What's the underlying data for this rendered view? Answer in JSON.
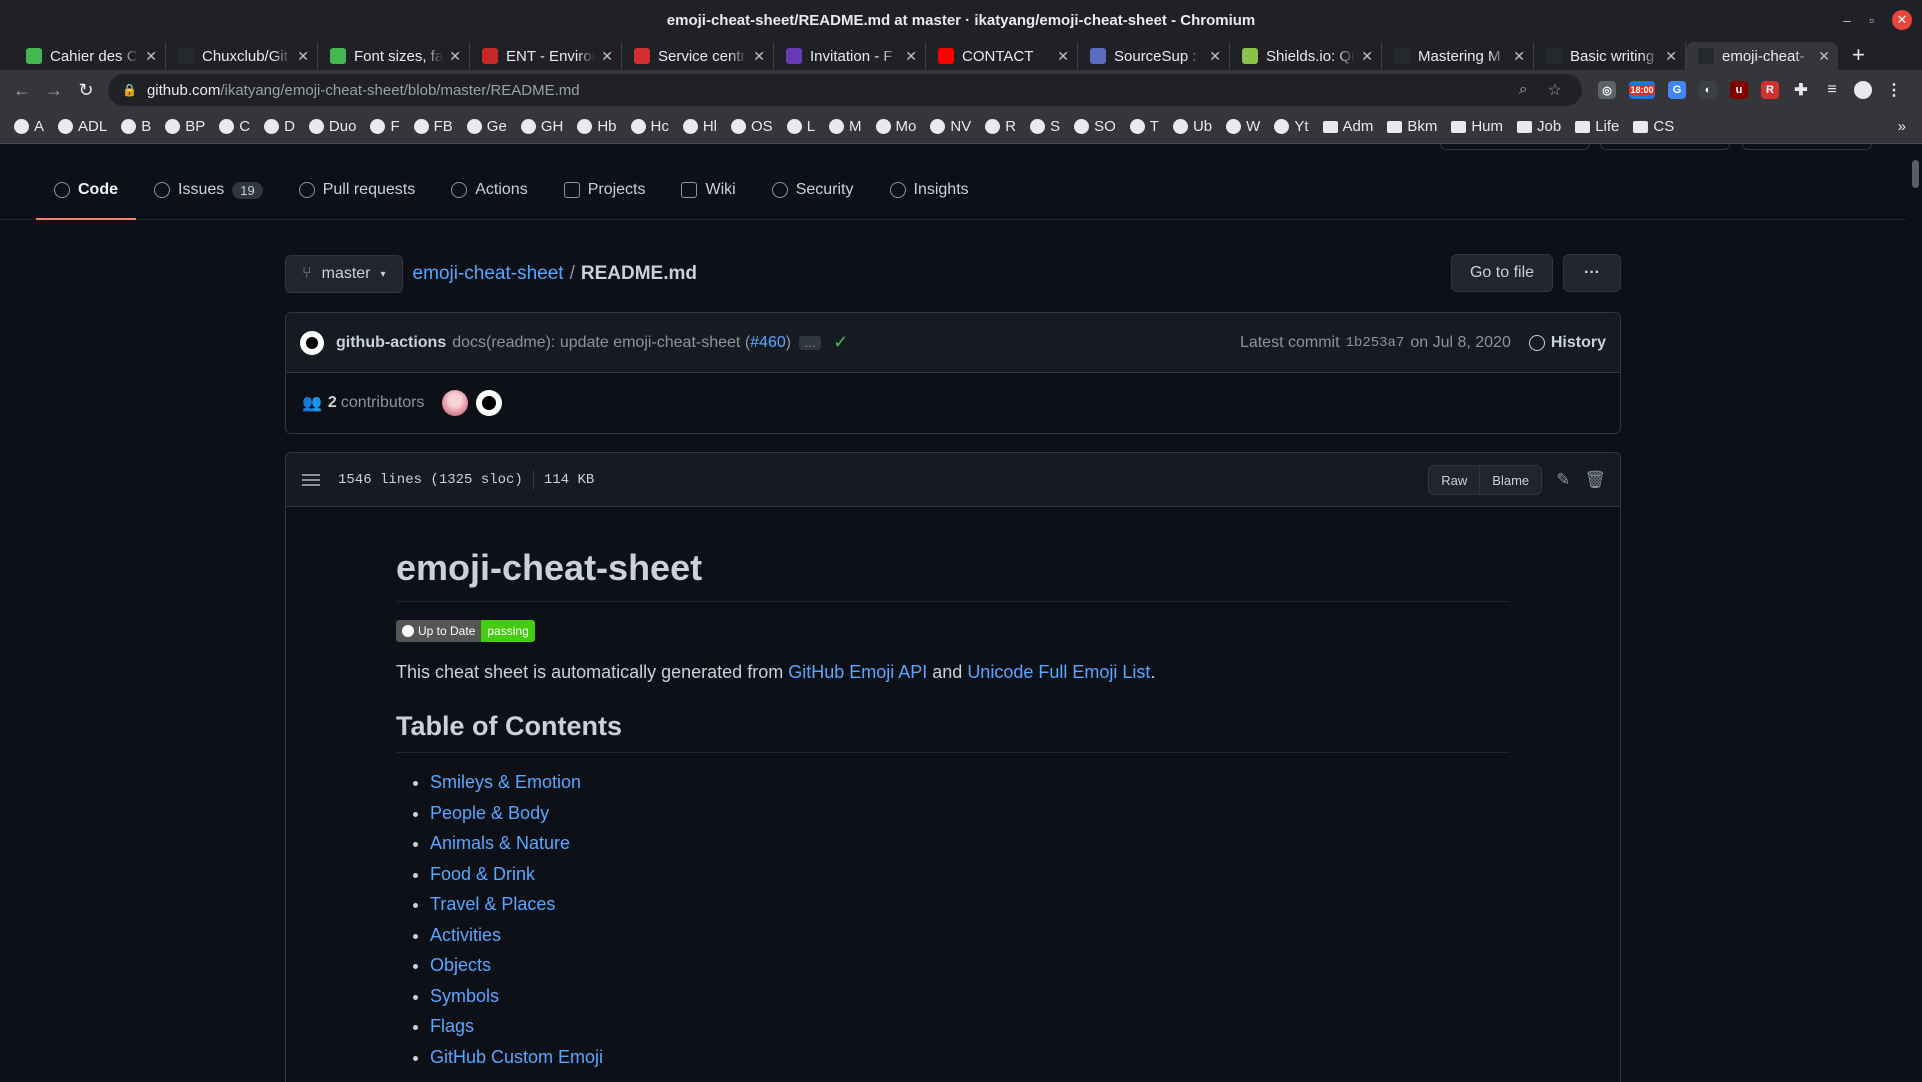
{
  "window": {
    "title": "emoji-cheat-sheet/README.md at master · ikatyang/emoji-cheat-sheet - Chromium"
  },
  "tabs": [
    {
      "label": "Cahier des Ch",
      "icon": "page-icon",
      "color": "#3fb950"
    },
    {
      "label": "Chuxclub/Git",
      "icon": "github-icon",
      "color": "#24292f"
    },
    {
      "label": "Font sizes, fa",
      "icon": "page-icon",
      "color": "#3fb950"
    },
    {
      "label": "ENT - Environ",
      "icon": "ent-icon",
      "color": "#c62828"
    },
    {
      "label": "Service centr",
      "icon": "service-icon",
      "color": "#d32f2f"
    },
    {
      "label": "Invitation - F",
      "icon": "form-icon",
      "color": "#673ab7"
    },
    {
      "label": "CONTACT",
      "icon": "youtube-icon",
      "color": "#ff0000"
    },
    {
      "label": "SourceSup : I",
      "icon": "sourcesup-icon",
      "color": "#5c6bc0"
    },
    {
      "label": "Shields.io: Qu",
      "icon": "shields-icon",
      "color": "#8bc34a"
    },
    {
      "label": "Mastering M",
      "icon": "github-icon",
      "color": "#24292f"
    },
    {
      "label": "Basic writing",
      "icon": "github-icon",
      "color": "#24292f"
    },
    {
      "label": "emoji-cheat-",
      "icon": "github-icon",
      "color": "#24292f"
    }
  ],
  "omnibox": {
    "host": "github.com",
    "path": "/ikatyang/emoji-cheat-sheet/blob/master/README.md"
  },
  "extensions": {
    "clock_badge": "18:00"
  },
  "bookmarks": [
    "A",
    "ADL",
    "B",
    "BP",
    "C",
    "D",
    "Duo",
    "F",
    "FB",
    "Ge",
    "GH",
    "Hb",
    "Hc",
    "Hl",
    "OS",
    "L",
    "M",
    "Mo",
    "NV",
    "R",
    "S",
    "SO",
    "T",
    "Ub",
    "W",
    "Yt"
  ],
  "bookmark_folders": [
    "Adm",
    "Bkm",
    "Hum",
    "Job",
    "Life",
    "CS"
  ],
  "repo_nav": [
    {
      "label": "Code",
      "icon": "code-icon"
    },
    {
      "label": "Issues",
      "icon": "issue-icon",
      "count": "19"
    },
    {
      "label": "Pull requests",
      "icon": "pull-request-icon"
    },
    {
      "label": "Actions",
      "icon": "actions-icon"
    },
    {
      "label": "Projects",
      "icon": "projects-icon"
    },
    {
      "label": "Wiki",
      "icon": "wiki-icon"
    },
    {
      "label": "Security",
      "icon": "shield-icon"
    },
    {
      "label": "Insights",
      "icon": "graph-icon"
    }
  ],
  "branch": "master",
  "breadcrumb": {
    "repo": "emoji-cheat-sheet",
    "separator": "/",
    "file": "README.md"
  },
  "buttons": {
    "go_to_file": "Go to file",
    "more": "···"
  },
  "commit": {
    "author": "github-actions",
    "message": "docs(readme): update emoji-cheat-sheet (",
    "pr": "#460",
    "message_end": ")",
    "ellipsis": "…",
    "latest_label": "Latest commit",
    "sha": "1b253a7",
    "date": "on Jul 8, 2020",
    "history": "History"
  },
  "contributors": {
    "count": "2",
    "label": "contributors"
  },
  "file": {
    "lines": "1546 lines (1325 sloc)",
    "size": "114 KB",
    "raw": "Raw",
    "blame": "Blame"
  },
  "readme": {
    "title": "emoji-cheat-sheet",
    "badge_left": "Up to Date",
    "badge_right": "passing",
    "intro_start": "This cheat sheet is automatically generated from ",
    "link1": "GitHub Emoji API",
    "intro_mid": " and ",
    "link2": "Unicode Full Emoji List",
    "intro_end": ".",
    "toc_title": "Table of Contents",
    "toc": [
      "Smileys & Emotion",
      "People & Body",
      "Animals & Nature",
      "Food & Drink",
      "Travel & Places",
      "Activities",
      "Objects",
      "Symbols",
      "Flags",
      "GitHub Custom Emoji"
    ]
  },
  "colors": {
    "accent": "#58a6ff",
    "tab_underline": "#f78166",
    "success": "#3fb950"
  }
}
